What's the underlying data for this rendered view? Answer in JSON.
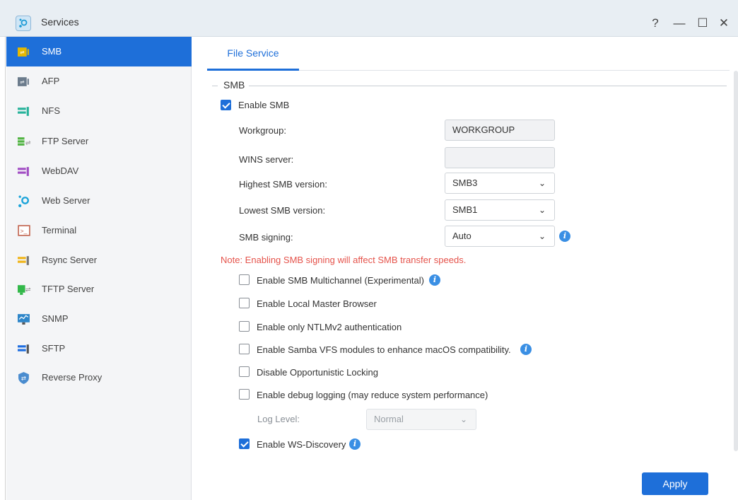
{
  "window": {
    "title": "Services",
    "help_glyph": "?",
    "minimize_glyph": "—",
    "maximize_glyph": "☐",
    "close_glyph": "✕"
  },
  "sidebar": {
    "items": [
      {
        "label": "SMB",
        "icon": "smb-icon",
        "color": "#e5b800"
      },
      {
        "label": "AFP",
        "icon": "afp-icon",
        "color": "#6b7b8c"
      },
      {
        "label": "NFS",
        "icon": "nfs-icon",
        "color": "#29b39b"
      },
      {
        "label": "FTP Server",
        "icon": "ftp-icon",
        "color": "#52b443"
      },
      {
        "label": "WebDAV",
        "icon": "webdav-icon",
        "color": "#a24fc4"
      },
      {
        "label": "Web Server",
        "icon": "web-server-icon",
        "color": "#1aa3d9"
      },
      {
        "label": "Terminal",
        "icon": "terminal-icon",
        "color": "#c0604a"
      },
      {
        "label": "Rsync Server",
        "icon": "rsync-icon",
        "color": "#f0b418"
      },
      {
        "label": "TFTP Server",
        "icon": "tftp-icon",
        "color": "#33b84a"
      },
      {
        "label": "SNMP",
        "icon": "snmp-icon",
        "color": "#2e86c9"
      },
      {
        "label": "SFTP",
        "icon": "sftp-icon",
        "color": "#1f6ee0"
      },
      {
        "label": "Reverse Proxy",
        "icon": "reverse-proxy-icon",
        "color": "#4a8ccf"
      }
    ]
  },
  "main": {
    "tab": "File Service",
    "section_title": "SMB",
    "enable_smb": "Enable SMB",
    "fields": {
      "workgroup_label": "Workgroup:",
      "workgroup_value": "WORKGROUP",
      "wins_label": "WINS server:",
      "wins_value": "",
      "highest_label": "Highest SMB version:",
      "highest_value": "SMB3",
      "lowest_label": "Lowest SMB version:",
      "lowest_value": "SMB1",
      "signing_label": "SMB signing:",
      "signing_value": "Auto"
    },
    "note": "Note: Enabling SMB signing will affect SMB transfer speeds.",
    "options": [
      {
        "label": "Enable SMB Multichannel (Experimental)",
        "checked": false,
        "info": true
      },
      {
        "label": "Enable Local Master Browser",
        "checked": false,
        "info": false
      },
      {
        "label": "Enable only NTLMv2 authentication",
        "checked": false,
        "info": false
      },
      {
        "label": "Enable Samba VFS modules to enhance macOS compatibility.",
        "checked": false,
        "info": true
      },
      {
        "label": "Disable Opportunistic Locking",
        "checked": false,
        "info": false
      },
      {
        "label": "Enable debug logging (may reduce system performance)",
        "checked": false,
        "info": false
      }
    ],
    "log_level_label": "Log Level:",
    "log_level_value": "Normal",
    "ws_discovery": "Enable WS-Discovery",
    "apply": "Apply"
  },
  "colors": {
    "accent": "#1e6fd9",
    "note": "#e5534b"
  }
}
